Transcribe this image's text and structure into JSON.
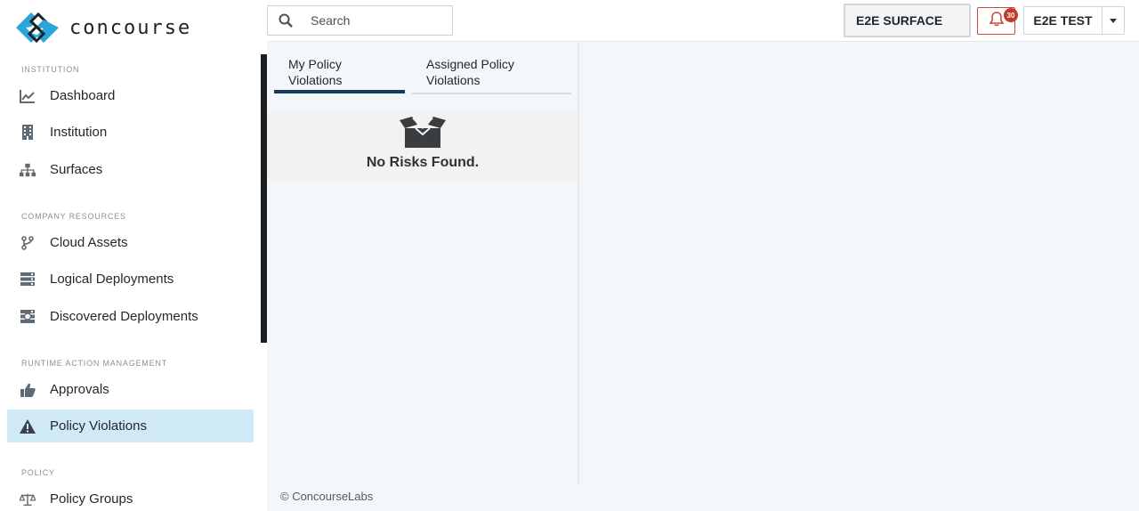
{
  "app": {
    "logo_text": "concourse"
  },
  "sidebar": {
    "sections": [
      {
        "label": "INSTITUTION",
        "items": [
          {
            "label": "Dashboard",
            "icon": "chart-line-icon"
          },
          {
            "label": "Institution",
            "icon": "building-icon"
          },
          {
            "label": "Surfaces",
            "icon": "sitemap-icon"
          }
        ]
      },
      {
        "label": "COMPANY RESOURCES",
        "items": [
          {
            "label": "Cloud Assets",
            "icon": "code-branch-icon"
          },
          {
            "label": "Logical Deployments",
            "icon": "server-icon"
          },
          {
            "label": "Discovered Deployments",
            "icon": "discovered-server-icon"
          }
        ]
      },
      {
        "label": "RUNTIME ACTION MANAGEMENT",
        "items": [
          {
            "label": "Approvals",
            "icon": "thumbs-up-icon"
          },
          {
            "label": "Policy Violations",
            "icon": "warning-icon",
            "active": true
          }
        ]
      },
      {
        "label": "POLICY",
        "items": [
          {
            "label": "Policy Groups",
            "icon": "balance-scale-icon"
          }
        ]
      }
    ]
  },
  "header": {
    "search_placeholder": "Search",
    "surface_label": "E2E SURFACE",
    "notification_count": "30",
    "user_label": "E2E TEST"
  },
  "panel": {
    "tabs": [
      {
        "label_line1": "My Policy",
        "label_line2": "Violations",
        "active": true
      },
      {
        "label_line1": "Assigned Policy",
        "label_line2": "Violations",
        "active": false
      }
    ],
    "empty_message": "No Risks Found."
  },
  "footer": {
    "copyright": "© ConcourseLabs"
  },
  "colors": {
    "accent": "#163a5f",
    "active_nav_bg": "#cfe9f6",
    "alert": "#cc4b37",
    "logo_blue": "#2aa7d8"
  }
}
